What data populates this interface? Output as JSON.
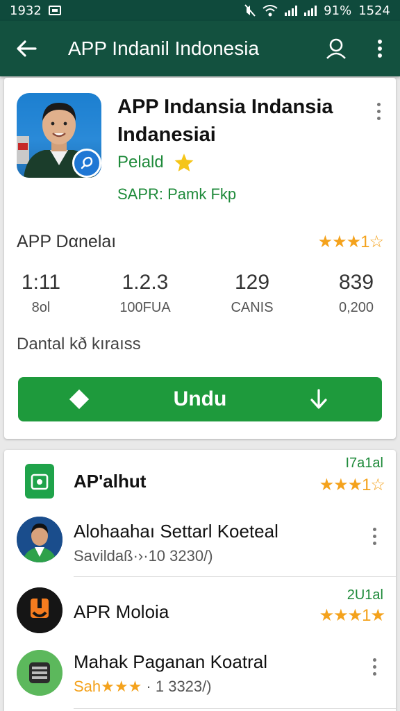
{
  "status": {
    "time": "1932",
    "battery": "91%",
    "clock": "1524"
  },
  "appbar": {
    "title": "APP Indanil Indonesia"
  },
  "app": {
    "title": "APP Indansia Indansia Indanesiai",
    "developer": "Pelald",
    "rating_tag": "SAPR: Pamk Fkp",
    "section_label": "APP Dαnelaı",
    "stars_text": "★★★1☆",
    "stats": [
      {
        "value": "1:11",
        "label": "8ol"
      },
      {
        "value": "1.2.3",
        "label": "100FUA"
      },
      {
        "value": "129",
        "label": "CANIS"
      },
      {
        "value": "839",
        "label": "0,200"
      }
    ],
    "description": "Dantal kð kıraıss",
    "install_label": "Undu"
  },
  "list": {
    "header": {
      "title": "AP'alhut",
      "right": "I7a1al",
      "stars": "★★★1☆"
    },
    "items": [
      {
        "title": "Alohaahaı Settarl Koeteal",
        "sub": "Savildaß·›·10 3230/)"
      },
      {
        "title": "APR Moloia",
        "right": "2U1al",
        "stars": "★★★1★"
      },
      {
        "title": "Mahak Paganan Koatral",
        "sub_stars": "Sah★★★",
        "sub": " · 1 3323/)"
      }
    ]
  },
  "colors": {
    "primary": "#13513f",
    "accent": "#1e9a3c",
    "star": "#f4a21c"
  }
}
